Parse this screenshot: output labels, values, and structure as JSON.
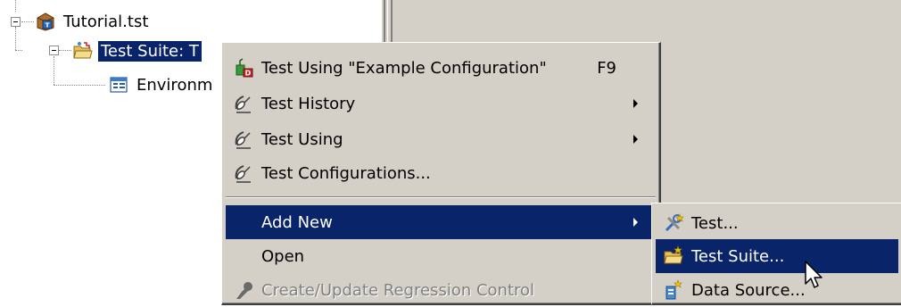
{
  "tree": {
    "root_label": "Tutorial.tst",
    "suite_label": "Test Suite: T",
    "env_label": "Environm"
  },
  "context_menu": {
    "items": [
      {
        "label": "Test Using \"Example Configuration\"",
        "shortcut": "F9",
        "icon": "test-config-icon"
      },
      {
        "label": "Test History",
        "icon": "satellite-icon",
        "submenu": true
      },
      {
        "label": "Test Using",
        "icon": "satellite-icon",
        "submenu": true
      },
      {
        "label": "Test Configurations...",
        "icon": "satellite-icon"
      },
      {
        "label": "Add New",
        "submenu": true,
        "highlighted": true
      },
      {
        "label": "Open"
      },
      {
        "label": "Create/Update Regression Control",
        "icon": "regression-icon",
        "disabled": true
      }
    ]
  },
  "add_new_submenu": {
    "items": [
      {
        "label": "Test...",
        "icon": "test-tools-icon"
      },
      {
        "label": "Test Suite...",
        "icon": "test-suite-folder-icon",
        "highlighted": true
      },
      {
        "label": "Data Source...",
        "icon": "data-source-icon"
      }
    ]
  },
  "colors": {
    "selection": "#0a246a",
    "menu_bg": "#d4d0c8",
    "disabled_text": "#808080"
  }
}
